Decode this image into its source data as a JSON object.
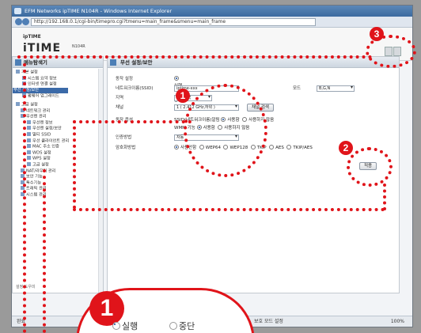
{
  "window": {
    "title": "EFM Networks ipTIME N104R - Windows Internet Explorer",
    "address": "http://192.168.0.1/cgi-bin/timepro.cgi?tmenu=main_frame&smenu=main_frame"
  },
  "banner": {
    "small_logo": "ipTIME",
    "logo": "iTIME",
    "sub_text": "N104R"
  },
  "left_panel": {
    "title": "메뉴탐색기",
    "items": [
      {
        "label": "기본 설정"
      },
      {
        "label": "시스템 요약 정보"
      },
      {
        "label": "인터넷 연결 설정"
      },
      {
        "label": "무선 설정/보안",
        "selected": true
      },
      {
        "label": "펌웨어 업그레이드"
      },
      {
        "label": "고급 설정"
      },
      {
        "label": "네트워크 관리"
      },
      {
        "label": "무선랜 관리"
      },
      {
        "label": "무선랜 정보"
      },
      {
        "label": "무선랜 설정/보안"
      },
      {
        "label": "멀티 SSID"
      },
      {
        "label": "무선 클라이언트 관리"
      },
      {
        "label": "MAC 주소 인증"
      },
      {
        "label": "WDS 설정"
      },
      {
        "label": "WPS 설정"
      },
      {
        "label": "고급 설정"
      },
      {
        "label": "NAT/라우터 관리"
      },
      {
        "label": "보안 기능"
      },
      {
        "label": "특수기능"
      },
      {
        "label": "트래픽 관리"
      },
      {
        "label": "시스템 관리"
      }
    ],
    "scroll_label": "설정 도우미"
  },
  "right_panel": {
    "title": "무선 설정/보안",
    "operation": {
      "label": "동작 설정",
      "run": "실행",
      "stop": "중단"
    },
    "ssid": {
      "label": "네트워크이름(SSID)",
      "value": "iptime-xxx"
    },
    "mode": {
      "label": "모드",
      "value": "B,G,N"
    },
    "region": {
      "label": "지역",
      "value": "대한민국"
    },
    "channel": {
      "label": "채널",
      "value": "1 ( 2.412 GHz,하위 )",
      "search_button": "채널 검색"
    },
    "operation_options": {
      "label": "동작 옵션",
      "ssid_hide": "SSID(네트워크이름)알림",
      "use": "사용함",
      "not_use": "사용하지 않음",
      "wmm": "WMM 기능",
      "wmm_use": "사용함",
      "wmm_not_use": "사용하지 않음"
    },
    "auth": {
      "label": "인증방법",
      "value": "자동"
    },
    "encryption": {
      "label": "암호화방법",
      "options": [
        "사용안함",
        "WEP64",
        "WEP128",
        "TKIP",
        "AES",
        "TKIP/AES"
      ]
    },
    "apply_button": "적용"
  },
  "statusbar": {
    "left_text": "완료",
    "mode_text": "보호 모드 설정",
    "zoom_text": "100%"
  },
  "callouts": [
    {
      "label": "1"
    },
    {
      "label": "2"
    },
    {
      "label": "3"
    }
  ],
  "zoom": {
    "badge": "1",
    "run": "실행",
    "stop": "중단"
  },
  "colors": {
    "callout_red": "#e0141a",
    "selection_blue": "#3b6aa8"
  }
}
